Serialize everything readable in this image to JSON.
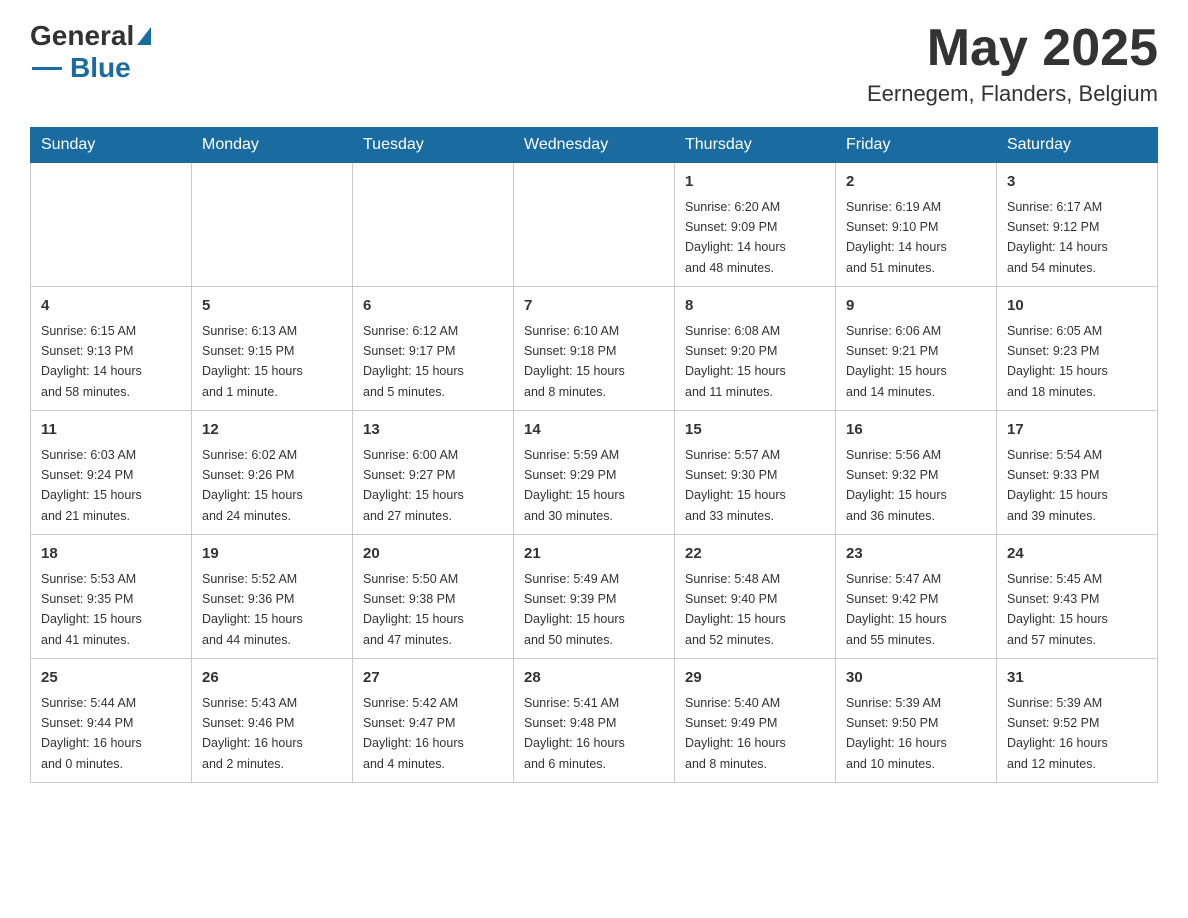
{
  "header": {
    "logo_general": "General",
    "logo_blue": "Blue",
    "month_year": "May 2025",
    "location": "Eernegem, Flanders, Belgium"
  },
  "calendar": {
    "days_of_week": [
      "Sunday",
      "Monday",
      "Tuesday",
      "Wednesday",
      "Thursday",
      "Friday",
      "Saturday"
    ],
    "weeks": [
      [
        {
          "day": "",
          "info": ""
        },
        {
          "day": "",
          "info": ""
        },
        {
          "day": "",
          "info": ""
        },
        {
          "day": "",
          "info": ""
        },
        {
          "day": "1",
          "info": "Sunrise: 6:20 AM\nSunset: 9:09 PM\nDaylight: 14 hours\nand 48 minutes."
        },
        {
          "day": "2",
          "info": "Sunrise: 6:19 AM\nSunset: 9:10 PM\nDaylight: 14 hours\nand 51 minutes."
        },
        {
          "day": "3",
          "info": "Sunrise: 6:17 AM\nSunset: 9:12 PM\nDaylight: 14 hours\nand 54 minutes."
        }
      ],
      [
        {
          "day": "4",
          "info": "Sunrise: 6:15 AM\nSunset: 9:13 PM\nDaylight: 14 hours\nand 58 minutes."
        },
        {
          "day": "5",
          "info": "Sunrise: 6:13 AM\nSunset: 9:15 PM\nDaylight: 15 hours\nand 1 minute."
        },
        {
          "day": "6",
          "info": "Sunrise: 6:12 AM\nSunset: 9:17 PM\nDaylight: 15 hours\nand 5 minutes."
        },
        {
          "day": "7",
          "info": "Sunrise: 6:10 AM\nSunset: 9:18 PM\nDaylight: 15 hours\nand 8 minutes."
        },
        {
          "day": "8",
          "info": "Sunrise: 6:08 AM\nSunset: 9:20 PM\nDaylight: 15 hours\nand 11 minutes."
        },
        {
          "day": "9",
          "info": "Sunrise: 6:06 AM\nSunset: 9:21 PM\nDaylight: 15 hours\nand 14 minutes."
        },
        {
          "day": "10",
          "info": "Sunrise: 6:05 AM\nSunset: 9:23 PM\nDaylight: 15 hours\nand 18 minutes."
        }
      ],
      [
        {
          "day": "11",
          "info": "Sunrise: 6:03 AM\nSunset: 9:24 PM\nDaylight: 15 hours\nand 21 minutes."
        },
        {
          "day": "12",
          "info": "Sunrise: 6:02 AM\nSunset: 9:26 PM\nDaylight: 15 hours\nand 24 minutes."
        },
        {
          "day": "13",
          "info": "Sunrise: 6:00 AM\nSunset: 9:27 PM\nDaylight: 15 hours\nand 27 minutes."
        },
        {
          "day": "14",
          "info": "Sunrise: 5:59 AM\nSunset: 9:29 PM\nDaylight: 15 hours\nand 30 minutes."
        },
        {
          "day": "15",
          "info": "Sunrise: 5:57 AM\nSunset: 9:30 PM\nDaylight: 15 hours\nand 33 minutes."
        },
        {
          "day": "16",
          "info": "Sunrise: 5:56 AM\nSunset: 9:32 PM\nDaylight: 15 hours\nand 36 minutes."
        },
        {
          "day": "17",
          "info": "Sunrise: 5:54 AM\nSunset: 9:33 PM\nDaylight: 15 hours\nand 39 minutes."
        }
      ],
      [
        {
          "day": "18",
          "info": "Sunrise: 5:53 AM\nSunset: 9:35 PM\nDaylight: 15 hours\nand 41 minutes."
        },
        {
          "day": "19",
          "info": "Sunrise: 5:52 AM\nSunset: 9:36 PM\nDaylight: 15 hours\nand 44 minutes."
        },
        {
          "day": "20",
          "info": "Sunrise: 5:50 AM\nSunset: 9:38 PM\nDaylight: 15 hours\nand 47 minutes."
        },
        {
          "day": "21",
          "info": "Sunrise: 5:49 AM\nSunset: 9:39 PM\nDaylight: 15 hours\nand 50 minutes."
        },
        {
          "day": "22",
          "info": "Sunrise: 5:48 AM\nSunset: 9:40 PM\nDaylight: 15 hours\nand 52 minutes."
        },
        {
          "day": "23",
          "info": "Sunrise: 5:47 AM\nSunset: 9:42 PM\nDaylight: 15 hours\nand 55 minutes."
        },
        {
          "day": "24",
          "info": "Sunrise: 5:45 AM\nSunset: 9:43 PM\nDaylight: 15 hours\nand 57 minutes."
        }
      ],
      [
        {
          "day": "25",
          "info": "Sunrise: 5:44 AM\nSunset: 9:44 PM\nDaylight: 16 hours\nand 0 minutes."
        },
        {
          "day": "26",
          "info": "Sunrise: 5:43 AM\nSunset: 9:46 PM\nDaylight: 16 hours\nand 2 minutes."
        },
        {
          "day": "27",
          "info": "Sunrise: 5:42 AM\nSunset: 9:47 PM\nDaylight: 16 hours\nand 4 minutes."
        },
        {
          "day": "28",
          "info": "Sunrise: 5:41 AM\nSunset: 9:48 PM\nDaylight: 16 hours\nand 6 minutes."
        },
        {
          "day": "29",
          "info": "Sunrise: 5:40 AM\nSunset: 9:49 PM\nDaylight: 16 hours\nand 8 minutes."
        },
        {
          "day": "30",
          "info": "Sunrise: 5:39 AM\nSunset: 9:50 PM\nDaylight: 16 hours\nand 10 minutes."
        },
        {
          "day": "31",
          "info": "Sunrise: 5:39 AM\nSunset: 9:52 PM\nDaylight: 16 hours\nand 12 minutes."
        }
      ]
    ]
  }
}
